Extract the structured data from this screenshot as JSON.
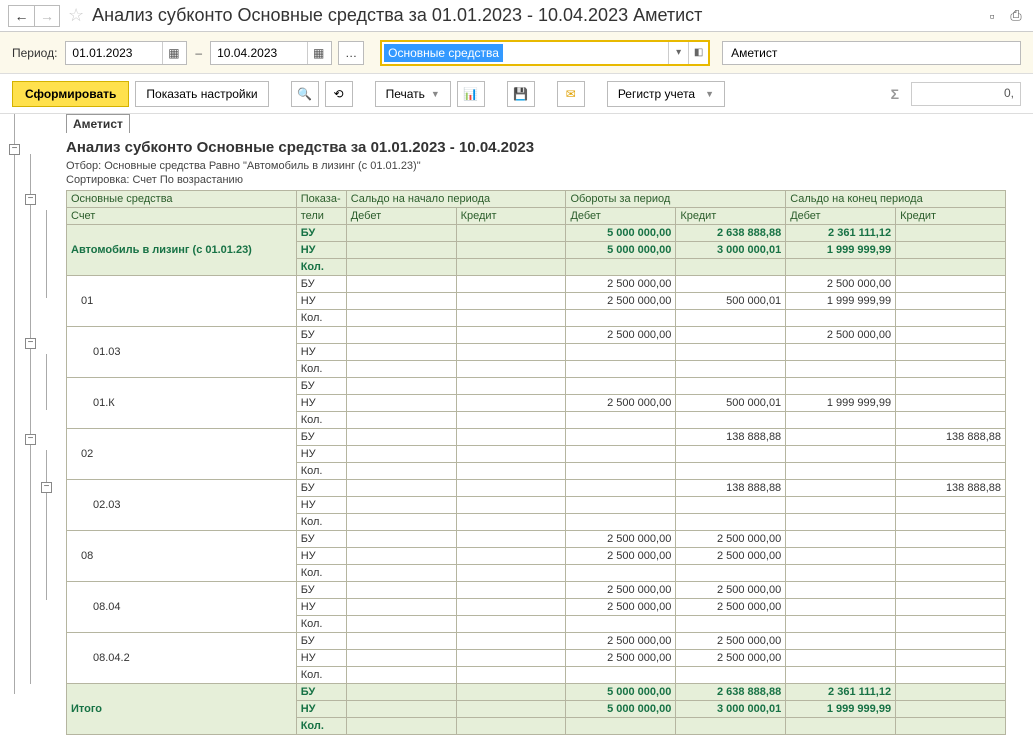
{
  "title": "Анализ субконто Основные средства за 01.01.2023 - 10.04.2023 Аметист",
  "period_label": "Период:",
  "date_from": "01.01.2023",
  "date_to": "10.04.2023",
  "subkonto_selected": "Основные средства",
  "organization": "Аметист",
  "btn": {
    "form": "Сформировать",
    "settings": "Показать настройки",
    "print": "Печать",
    "register": "Регистр учета"
  },
  "sum_value": "0,",
  "report": {
    "org": "Аметист",
    "title": "Анализ субконто Основные средства за 01.01.2023 - 10.04.2023",
    "filter": "Отбор: Основные средства Равно \"Автомобиль в лизинг (с 01.01.23)\"",
    "sort": "Сортировка: Счет По возрастанию"
  },
  "headers": {
    "dim": "Основные средства",
    "acc": "Счет",
    "ind": "Показа-",
    "ind2": "тели",
    "start": "Сальдо на начало периода",
    "turn": "Обороты за период",
    "end": "Сальдо на конец периода",
    "debit": "Дебет",
    "credit": "Кредит"
  },
  "indicators": {
    "bu": "БУ",
    "nu": "НУ",
    "kol": "Кол."
  },
  "rows": [
    {
      "type": "group",
      "name": "Автомобиль в лизинг (с 01.01.23)",
      "indent": 0,
      "bu": {
        "sd": "",
        "sc": "",
        "td": "5 000 000,00",
        "tc": "2 638 888,88",
        "ed": "2 361 111,12",
        "ec": ""
      },
      "nu": {
        "sd": "",
        "sc": "",
        "td": "5 000 000,00",
        "tc": "3 000 000,01",
        "ed": "1 999 999,99",
        "ec": ""
      },
      "kol": {
        "sd": "",
        "sc": "",
        "td": "",
        "tc": "",
        "ed": "",
        "ec": ""
      }
    },
    {
      "type": "acc",
      "name": "01",
      "indent": 1,
      "bu": {
        "sd": "",
        "sc": "",
        "td": "2 500 000,00",
        "tc": "",
        "ed": "2 500 000,00",
        "ec": ""
      },
      "nu": {
        "sd": "",
        "sc": "",
        "td": "2 500 000,00",
        "tc": "500 000,01",
        "ed": "1 999 999,99",
        "ec": ""
      },
      "kol": {
        "sd": "",
        "sc": "",
        "td": "",
        "tc": "",
        "ed": "",
        "ec": ""
      }
    },
    {
      "type": "acc",
      "name": "01.03",
      "indent": 2,
      "bu": {
        "sd": "",
        "sc": "",
        "td": "2 500 000,00",
        "tc": "",
        "ed": "2 500 000,00",
        "ec": ""
      },
      "nu": {
        "sd": "",
        "sc": "",
        "td": "",
        "tc": "",
        "ed": "",
        "ec": ""
      },
      "kol": {
        "sd": "",
        "sc": "",
        "td": "",
        "tc": "",
        "ed": "",
        "ec": ""
      }
    },
    {
      "type": "acc",
      "name": "01.К",
      "indent": 2,
      "bu": {
        "sd": "",
        "sc": "",
        "td": "",
        "tc": "",
        "ed": "",
        "ec": ""
      },
      "nu": {
        "sd": "",
        "sc": "",
        "td": "2 500 000,00",
        "tc": "500 000,01",
        "ed": "1 999 999,99",
        "ec": ""
      },
      "kol": {
        "sd": "",
        "sc": "",
        "td": "",
        "tc": "",
        "ed": "",
        "ec": ""
      }
    },
    {
      "type": "acc",
      "name": "02",
      "indent": 1,
      "bu": {
        "sd": "",
        "sc": "",
        "td": "",
        "tc": "138 888,88",
        "ed": "",
        "ec": "138 888,88"
      },
      "nu": {
        "sd": "",
        "sc": "",
        "td": "",
        "tc": "",
        "ed": "",
        "ec": ""
      },
      "kol": {
        "sd": "",
        "sc": "",
        "td": "",
        "tc": "",
        "ed": "",
        "ec": ""
      }
    },
    {
      "type": "acc",
      "name": "02.03",
      "indent": 2,
      "bu": {
        "sd": "",
        "sc": "",
        "td": "",
        "tc": "138 888,88",
        "ed": "",
        "ec": "138 888,88"
      },
      "nu": {
        "sd": "",
        "sc": "",
        "td": "",
        "tc": "",
        "ed": "",
        "ec": ""
      },
      "kol": {
        "sd": "",
        "sc": "",
        "td": "",
        "tc": "",
        "ed": "",
        "ec": ""
      }
    },
    {
      "type": "acc",
      "name": "08",
      "indent": 1,
      "bu": {
        "sd": "",
        "sc": "",
        "td": "2 500 000,00",
        "tc": "2 500 000,00",
        "ed": "",
        "ec": ""
      },
      "nu": {
        "sd": "",
        "sc": "",
        "td": "2 500 000,00",
        "tc": "2 500 000,00",
        "ed": "",
        "ec": ""
      },
      "kol": {
        "sd": "",
        "sc": "",
        "td": "",
        "tc": "",
        "ed": "",
        "ec": ""
      }
    },
    {
      "type": "acc",
      "name": "08.04",
      "indent": 2,
      "bu": {
        "sd": "",
        "sc": "",
        "td": "2 500 000,00",
        "tc": "2 500 000,00",
        "ed": "",
        "ec": ""
      },
      "nu": {
        "sd": "",
        "sc": "",
        "td": "2 500 000,00",
        "tc": "2 500 000,00",
        "ed": "",
        "ec": ""
      },
      "kol": {
        "sd": "",
        "sc": "",
        "td": "",
        "tc": "",
        "ed": "",
        "ec": ""
      }
    },
    {
      "type": "acc",
      "name": "08.04.2",
      "indent": 2,
      "bu": {
        "sd": "",
        "sc": "",
        "td": "2 500 000,00",
        "tc": "2 500 000,00",
        "ed": "",
        "ec": ""
      },
      "nu": {
        "sd": "",
        "sc": "",
        "td": "2 500 000,00",
        "tc": "2 500 000,00",
        "ed": "",
        "ec": ""
      },
      "kol": {
        "sd": "",
        "sc": "",
        "td": "",
        "tc": "",
        "ed": "",
        "ec": ""
      }
    }
  ],
  "total": {
    "name": "Итого",
    "bu": {
      "sd": "",
      "sc": "",
      "td": "5 000 000,00",
      "tc": "2 638 888,88",
      "ed": "2 361 111,12",
      "ec": ""
    },
    "nu": {
      "sd": "",
      "sc": "",
      "td": "5 000 000,00",
      "tc": "3 000 000,01",
      "ed": "1 999 999,99",
      "ec": ""
    },
    "kol": {
      "sd": "",
      "sc": "",
      "td": "",
      "tc": "",
      "ed": "",
      "ec": ""
    }
  }
}
